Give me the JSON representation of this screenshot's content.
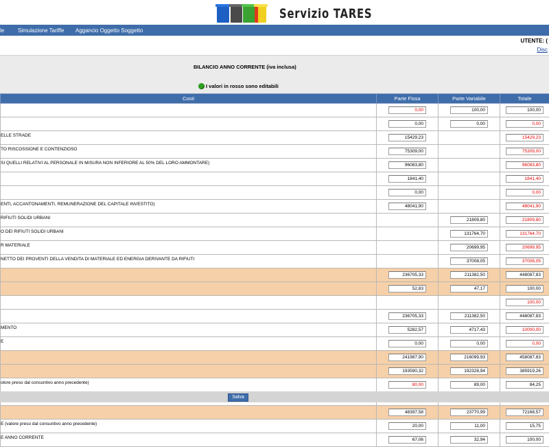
{
  "header": {
    "brand": "Servizio TARES"
  },
  "nav": {
    "items": [
      "le",
      "Simulazione Tariffe",
      "Aggancio Oggetto Soggetto"
    ]
  },
  "user": {
    "utente_label": "UTENTE: (",
    "disconnect_label": "Disc"
  },
  "panel": {
    "title": "BILANCIO ANNO CORRENTE (iva inclusa)",
    "note": "I valori in rosso sono editabili"
  },
  "table": {
    "headers": [
      "Costi",
      "Parte Fissa",
      "Parte Variabile",
      "Totale"
    ],
    "rows": [
      {
        "label": "",
        "fissa": "0,00",
        "fissa_red": true,
        "variabile": "100,00",
        "totale": "100,00",
        "orange": false
      },
      {
        "label": "",
        "fissa": "0,00",
        "variabile": "0,00",
        "totale": "0,00",
        "totale_red": true
      },
      {
        "label": "ELLE STRADE",
        "fissa": "15429,23",
        "totale": "15429,23",
        "totale_red": true
      },
      {
        "label": "TO RISCOSSIONE E CONTENZIOSO",
        "fissa": "75309,00",
        "totale": "75309,00",
        "totale_red": true
      },
      {
        "label": "SI QUELLI RELATIVI AL PERSONALE IN MISURA NON INFERIORE AL 50% DEL LORO AMMONTARE)",
        "fissa": "96083,80",
        "totale": "96083,80",
        "totale_red": true
      },
      {
        "label": "",
        "fissa": "1841,40",
        "totale": "1841,40",
        "totale_red": true
      },
      {
        "label": "",
        "fissa": "0,00",
        "totale": "0,00",
        "totale_red": true
      },
      {
        "label": "ENTI, ACCANTONAMENTI, REMUNERAZIONE DEL CAPITALE INVESTITO)",
        "fissa": "48041,90",
        "totale": "48041,90",
        "totale_red": true
      },
      {
        "label": "RIFIUTI SOLIDI URBANI",
        "variabile": "21809,80",
        "totale": "21809,80",
        "totale_red": true
      },
      {
        "label": "O DEI RIFIUTI SOLIDI URBANI",
        "variabile": "131764,70",
        "totale": "131764,70",
        "totale_red": true
      },
      {
        "label": "R MATERIALE",
        "variabile": "20699,95",
        "totale": "20699,95",
        "totale_red": true
      },
      {
        "label": "NETTO DEI PROVENTI DELLA VENDITA DI MATERIALE ED ENERGIA DERIVANTE DA RIFIUTI",
        "variabile": "37008,05",
        "totale": "37008,05",
        "totale_red": true
      },
      {
        "label": "",
        "fissa": "236705,33",
        "variabile": "211382,50",
        "totale": "448087,83",
        "orange": true
      },
      {
        "label": "",
        "fissa": "52,83",
        "variabile": "47,17",
        "totale": "100,00",
        "orange": true
      },
      {
        "label": "",
        "totale": "100,00",
        "totale_red": true
      },
      {
        "label": "",
        "fissa": "236705,33",
        "variabile": "211382,50",
        "totale": "448087,83"
      },
      {
        "label": "MENTO",
        "fissa": "5282,57",
        "variabile": "4717,43",
        "totale": "10000,00",
        "totale_red": true
      },
      {
        "label": "E",
        "fissa": "0,00",
        "variabile": "0,00",
        "totale": "0,00",
        "totale_red": true
      },
      {
        "label": "",
        "fissa": "241987,90",
        "variabile": "216099,93",
        "totale": "458087,83",
        "orange": true
      },
      {
        "label": "",
        "fissa": "193590,32",
        "variabile": "192328,94",
        "totale": "385919,26",
        "orange": true
      },
      {
        "label": "olore preso dal consuntivo anno precedente)",
        "fissa": "80,00",
        "fissa_red": true,
        "variabile": "89,00",
        "totale": "84,25"
      },
      {
        "label": "NO CORRENTE",
        "fissa": "50,16",
        "variabile": "49,84",
        "totale": "100,00"
      },
      {
        "label": "",
        "fissa": "48397,58",
        "variabile": "23770,99",
        "totale": "72168,57",
        "orange": true
      },
      {
        "label": "E (valore preso dal consuntivo anno precedente)",
        "fissa": "20,00",
        "variabile": "11,00",
        "totale": "15,75"
      },
      {
        "label": "E ANNO CORRENTE",
        "fissa": "67,06",
        "variabile": "32,94",
        "totale": "100,00"
      }
    ]
  },
  "footer": {
    "save_label": "Salva"
  }
}
